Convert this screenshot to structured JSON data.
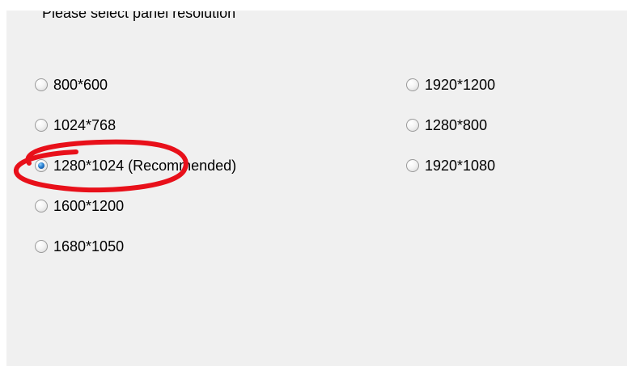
{
  "dialog": {
    "prompt": "Please select panel resolution",
    "options": [
      {
        "label": "800*600",
        "checked": false
      },
      {
        "label": "1024*768",
        "checked": false
      },
      {
        "label": "1280*1024 (Recommended)",
        "checked": true
      },
      {
        "label": "1600*1200",
        "checked": false
      },
      {
        "label": "1680*1050",
        "checked": false
      },
      {
        "label": "1920*1200",
        "checked": false
      },
      {
        "label": "1280*800",
        "checked": false
      },
      {
        "label": "1920*1080",
        "checked": false
      }
    ]
  },
  "annotation": {
    "shape": "ellipse",
    "color": "#e8101a",
    "target": "1280*1024 (Recommended)"
  }
}
